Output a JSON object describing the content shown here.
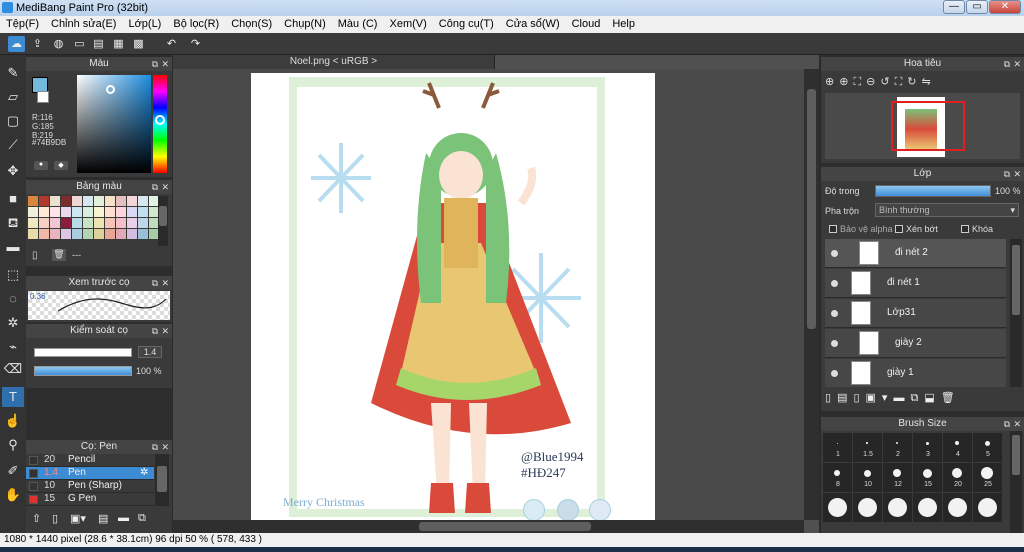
{
  "window": {
    "title": "MediBang Paint Pro (32bit)",
    "minimize": "—",
    "maximize": "▭",
    "close": "✕"
  },
  "menu": [
    "Tệp(F)",
    "Chỉnh sửa(E)",
    "Lớp(L)",
    "Bộ lọc(R)",
    "Chọn(S)",
    "Chụp(N)",
    "Màu (C)",
    "Xem(V)",
    "Công cụ(T)",
    "Cửa sổ(W)",
    "Cloud",
    "Help"
  ],
  "toolbar_icons": [
    "cloud-icon",
    "export-icon",
    "comment-icon",
    "page-icon",
    "doc-icon",
    "grid-icon",
    "tiles-icon",
    "undo-icon",
    "redo-icon"
  ],
  "color_panel": {
    "title": "Màu",
    "r": "R:116",
    "g": "G:185",
    "b": "B:219",
    "hex": "#74B9DB",
    "fg": "#74b9db",
    "bg": "#ffffff"
  },
  "palette_panel": {
    "title": "Bảng màu",
    "dashes": "---"
  },
  "palette_colors": [
    "#d9873f",
    "#b03b2c",
    "#e9e0d0",
    "#7c2e2e",
    "#f0d7d7",
    "#d6e6f0",
    "#e3f0d9",
    "#f5e1c8",
    "#e6c0c0",
    "#f4d5da",
    "#d8e8ef",
    "#e2f3e4",
    "#f0f0d8",
    "#ffe9d6",
    "#fde3ea",
    "#ead8ef",
    "#cde6f2",
    "#d7efde",
    "#f7f2cf",
    "#ffdfd0",
    "#ffd6e0",
    "#d9d9f5",
    "#c2e0ee",
    "#cfe9cf",
    "#f0e8c0",
    "#f7cfc0",
    "#f2c6d2",
    "#8a1d3b",
    "#b8dbe9",
    "#c8e3c8",
    "#efe3b3",
    "#f5c5b5",
    "#f4c0cc",
    "#e8d0e8",
    "#bcd8e8",
    "#bfdcbf",
    "#e9dca8",
    "#f0b8a6",
    "#e8b4c0",
    "#dcc6e4",
    "#aacde0",
    "#b3d5b3",
    "#e0d099",
    "#e6a894",
    "#e0a8b6",
    "#d4bce0",
    "#98c0d8",
    "#a6cea6"
  ],
  "preview_panel": {
    "title": "Xem trước cọ",
    "size": "0.36"
  },
  "control_panel": {
    "title": "Kiểm soát cọ",
    "size_value": "1.4",
    "opacity_value": "100 %"
  },
  "brush_list": {
    "title": "Cọ: Pen",
    "items": [
      {
        "size": "20",
        "name": "Pencil",
        "color": "#333333",
        "selected": false
      },
      {
        "size": "1.4",
        "name": "Pen",
        "color": "#333333",
        "selected": true
      },
      {
        "size": "10",
        "name": "Pen (Sharp)",
        "color": "#333333",
        "selected": false
      },
      {
        "size": "15",
        "name": "G Pen",
        "color": "#e03030",
        "selected": false
      }
    ]
  },
  "document": {
    "tab": "Noel.png < uRGB >",
    "signature1": "@Blue1994",
    "signature2": "#HĐ247",
    "caption": "Merry Christmas"
  },
  "navigator": {
    "title": "Hoa tiêu"
  },
  "layers_panel": {
    "title": "Lớp",
    "opacity_label": "Độ trong",
    "opacity_value": "100 %",
    "opacity_fraction": 1.0,
    "blend_label": "Pha trộn",
    "blend_value": "Bình thường",
    "protect_alpha": "Bảo vệ alpha",
    "clipping": "Xén bớt",
    "lock": "Khóa",
    "layers": [
      {
        "name": "đi nét 2",
        "indent": true,
        "selected": true
      },
      {
        "name": "đi nét 1",
        "indent": false,
        "selected": false
      },
      {
        "name": "Lớp31",
        "indent": false,
        "selected": false
      },
      {
        "name": "giày 2",
        "indent": true,
        "selected": false
      },
      {
        "name": "giày 1",
        "indent": false,
        "selected": false
      }
    ]
  },
  "brush_size": {
    "title": "Brush Size",
    "labels": [
      "1",
      "1.5",
      "2",
      "3",
      "4",
      "5",
      "8",
      "10",
      "12",
      "15",
      "20",
      "25"
    ]
  },
  "status": {
    "dimensions": "1080 * 1440 pixel",
    "physical": "(28.6 * 38.1cm)",
    "dpi": "96 dpi",
    "zoom": "50 %",
    "cursor": "( 578, 433 )"
  }
}
